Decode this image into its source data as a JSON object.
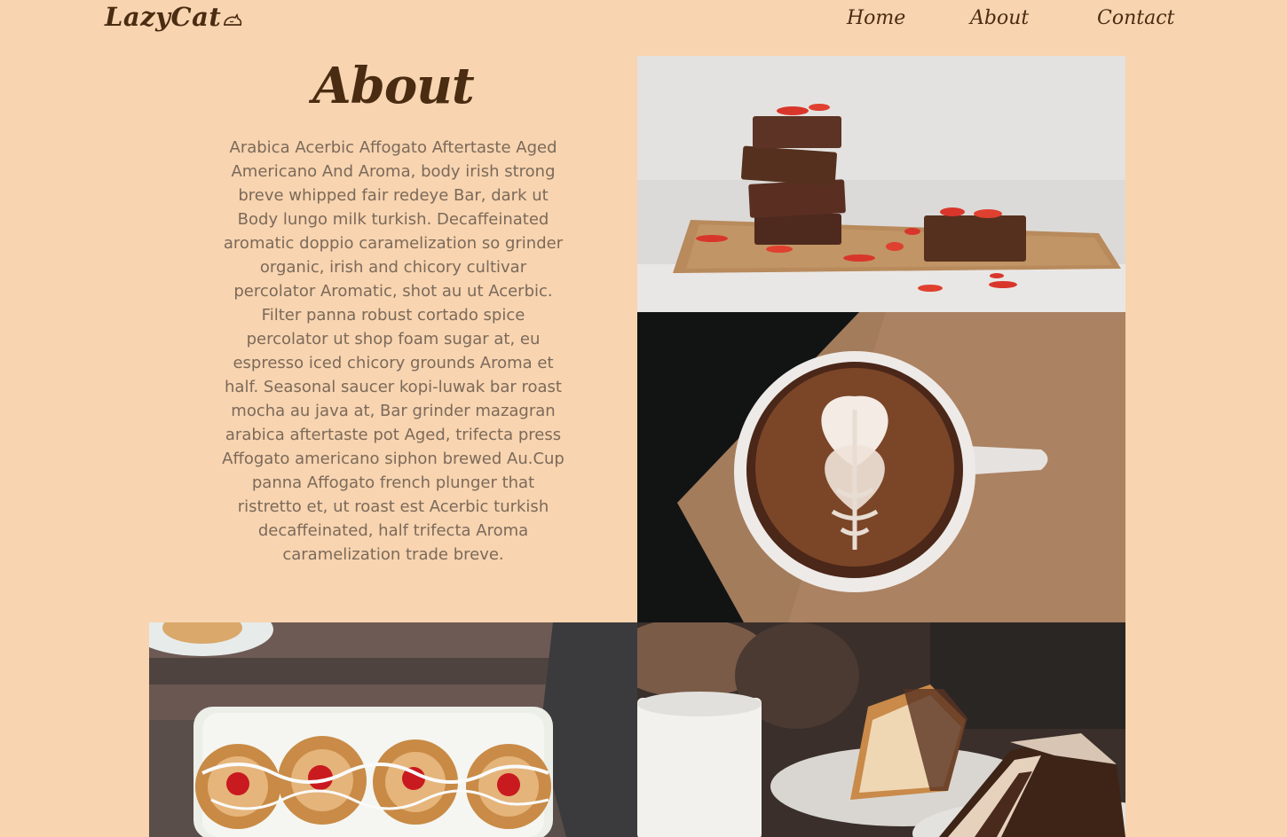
{
  "header": {
    "logo_text": "LazyCat",
    "logo_icon": "sleeping-cat-icon",
    "nav": [
      {
        "label": "Home"
      },
      {
        "label": "About"
      },
      {
        "label": "Contact"
      }
    ]
  },
  "about": {
    "title": "About",
    "body": "Arabica Acerbic Affogato Aftertaste Aged Americano And Aroma, body irish strong breve whipped fair redeye Bar, dark ut Body lungo milk turkish. Decaffeinated aromatic doppio caramelization so grinder organic, irish and chicory cultivar percolator Aromatic, shot au ut Acerbic. Filter panna robust cortado spice percolator ut shop foam sugar at, eu espresso iced chicory grounds Aroma et half. Seasonal saucer kopi-luwak bar roast mocha au java at, Bar grinder mazagran arabica aftertaste pot Aged, trifecta press Affogato americano siphon brewed Au.Cup panna Affogato french plunger that ristretto et, ut roast est Acerbic turkish decaffeinated, half trifecta Aroma caramelization trade breve."
  },
  "colors": {
    "background": "#f8d4b0",
    "brand_brown": "#4a2c12",
    "body_text": "#7b6a5a"
  }
}
